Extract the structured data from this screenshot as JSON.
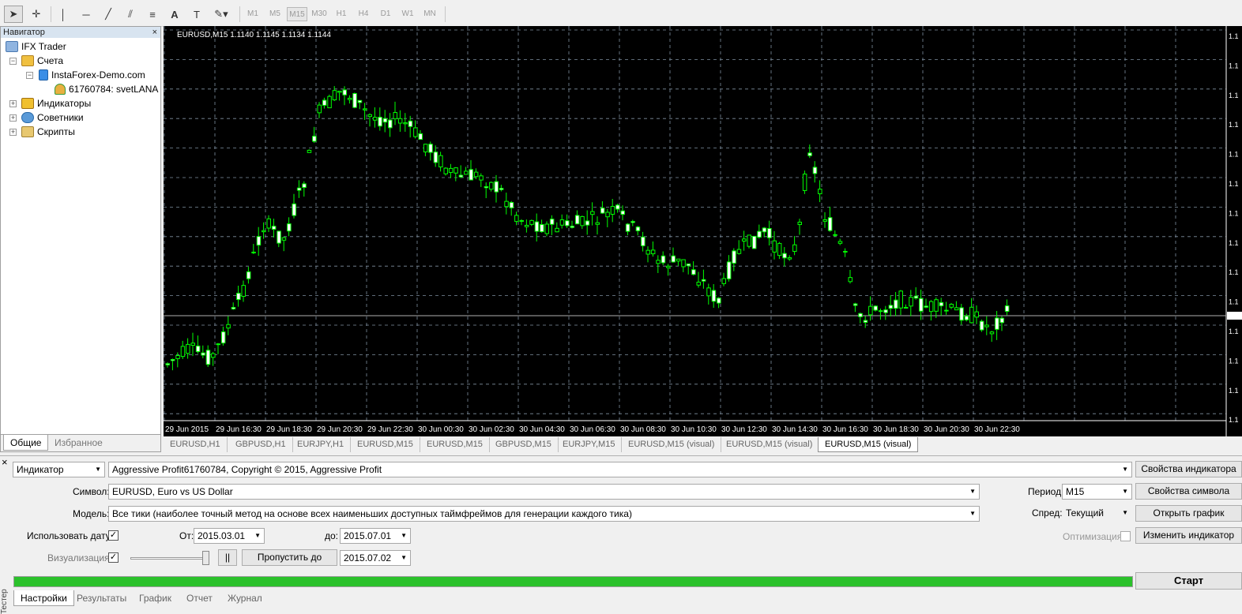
{
  "toolbar": {
    "timeframes": [
      "M1",
      "M5",
      "M15",
      "M30",
      "H1",
      "H4",
      "D1",
      "W1",
      "MN"
    ],
    "active_timeframe": "M15"
  },
  "navigator": {
    "title": "Навигатор",
    "close": "×",
    "root": "IFX Trader",
    "accounts": "Счета",
    "server": "InstaForex-Demo.com",
    "account": "61760784: svetLANA",
    "indicators": "Индикаторы",
    "advisors": "Советники",
    "scripts": "Скрипты",
    "tabs": [
      "Общие",
      "Избранное"
    ]
  },
  "chart": {
    "header": "EURUSD,M15  1.1140 1.1145 1.1134 1.1144",
    "bull_color": "#00ff00",
    "bear_color": "#ffffff",
    "grid_color": "#7f8fa0",
    "time_labels": [
      "29 Jun 2015",
      "29 Jun 16:30",
      "29 Jun 18:30",
      "29 Jun 20:30",
      "29 Jun 22:30",
      "30 Jun 00:30",
      "30 Jun 02:30",
      "30 Jun 04:30",
      "30 Jun 06:30",
      "30 Jun 08:30",
      "30 Jun 10:30",
      "30 Jun 12:30",
      "30 Jun 14:30",
      "30 Jun 16:30",
      "30 Jun 18:30",
      "30 Jun 20:30",
      "30 Jun 22:30"
    ],
    "price_label": "1.1"
  },
  "chart_tabs": [
    "EURUSD,H1",
    "GBPUSD,H1",
    "EURJPY,H1",
    "EURUSD,M15",
    "EURUSD,M15",
    "GBPUSD,M15",
    "EURJPY,M15",
    "EURUSD,M15 (visual)",
    "EURUSD,M15 (visual)",
    "EURUSD,M15 (visual)"
  ],
  "tester": {
    "type_value": "Индикатор",
    "expert_value": "Aggressive Profit61760784, Copyright © 2015, Aggressive Profit",
    "props_button": "Свойства индикатора",
    "symbol_label": "Символ:",
    "symbol_value": "EURUSD, Euro vs US Dollar",
    "period_label": "Период:",
    "period_value": "M15",
    "symbol_props_button": "Свойства символа",
    "model_label": "Модель:",
    "model_value": "Все тики (наиболее точный метод на основе всех наименьших доступных таймфреймов для генерации каждого тика)",
    "spread_label": "Спред:",
    "spread_value": "Текущий",
    "open_chart_button": "Открыть график",
    "use_date_label": "Использовать дату",
    "from_label": "От:",
    "from_value": "2015.03.01",
    "to_label": "до:",
    "to_value": "2015.07.01",
    "optimization_label": "Оптимизация",
    "change_indicator_button": "Изменить индикатор",
    "visualization_label": "Визуализация",
    "pause_button": "||",
    "skip_button": "Пропустить до",
    "skip_value": "2015.07.02",
    "start_button": "Старт",
    "side_label": "Тестер",
    "tabs": [
      "Настройки",
      "Результаты",
      "График",
      "Отчет",
      "Журнал"
    ],
    "check_mark": "✓",
    "close": "×"
  }
}
